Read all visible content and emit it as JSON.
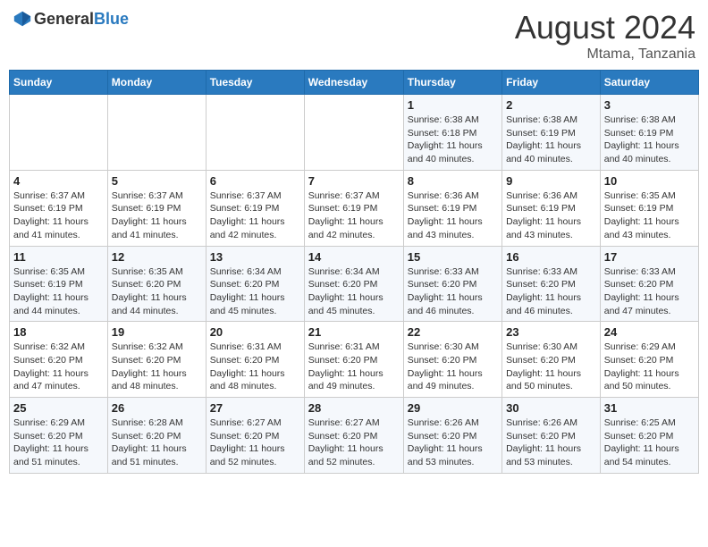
{
  "header": {
    "logo_general": "General",
    "logo_blue": "Blue",
    "month_title": "August 2024",
    "location": "Mtama, Tanzania"
  },
  "weekdays": [
    "Sunday",
    "Monday",
    "Tuesday",
    "Wednesday",
    "Thursday",
    "Friday",
    "Saturday"
  ],
  "weeks": [
    [
      {
        "day": "",
        "info": ""
      },
      {
        "day": "",
        "info": ""
      },
      {
        "day": "",
        "info": ""
      },
      {
        "day": "",
        "info": ""
      },
      {
        "day": "1",
        "info": "Sunrise: 6:38 AM\nSunset: 6:18 PM\nDaylight: 11 hours and 40 minutes."
      },
      {
        "day": "2",
        "info": "Sunrise: 6:38 AM\nSunset: 6:19 PM\nDaylight: 11 hours and 40 minutes."
      },
      {
        "day": "3",
        "info": "Sunrise: 6:38 AM\nSunset: 6:19 PM\nDaylight: 11 hours and 40 minutes."
      }
    ],
    [
      {
        "day": "4",
        "info": "Sunrise: 6:37 AM\nSunset: 6:19 PM\nDaylight: 11 hours and 41 minutes."
      },
      {
        "day": "5",
        "info": "Sunrise: 6:37 AM\nSunset: 6:19 PM\nDaylight: 11 hours and 41 minutes."
      },
      {
        "day": "6",
        "info": "Sunrise: 6:37 AM\nSunset: 6:19 PM\nDaylight: 11 hours and 42 minutes."
      },
      {
        "day": "7",
        "info": "Sunrise: 6:37 AM\nSunset: 6:19 PM\nDaylight: 11 hours and 42 minutes."
      },
      {
        "day": "8",
        "info": "Sunrise: 6:36 AM\nSunset: 6:19 PM\nDaylight: 11 hours and 43 minutes."
      },
      {
        "day": "9",
        "info": "Sunrise: 6:36 AM\nSunset: 6:19 PM\nDaylight: 11 hours and 43 minutes."
      },
      {
        "day": "10",
        "info": "Sunrise: 6:35 AM\nSunset: 6:19 PM\nDaylight: 11 hours and 43 minutes."
      }
    ],
    [
      {
        "day": "11",
        "info": "Sunrise: 6:35 AM\nSunset: 6:19 PM\nDaylight: 11 hours and 44 minutes."
      },
      {
        "day": "12",
        "info": "Sunrise: 6:35 AM\nSunset: 6:20 PM\nDaylight: 11 hours and 44 minutes."
      },
      {
        "day": "13",
        "info": "Sunrise: 6:34 AM\nSunset: 6:20 PM\nDaylight: 11 hours and 45 minutes."
      },
      {
        "day": "14",
        "info": "Sunrise: 6:34 AM\nSunset: 6:20 PM\nDaylight: 11 hours and 45 minutes."
      },
      {
        "day": "15",
        "info": "Sunrise: 6:33 AM\nSunset: 6:20 PM\nDaylight: 11 hours and 46 minutes."
      },
      {
        "day": "16",
        "info": "Sunrise: 6:33 AM\nSunset: 6:20 PM\nDaylight: 11 hours and 46 minutes."
      },
      {
        "day": "17",
        "info": "Sunrise: 6:33 AM\nSunset: 6:20 PM\nDaylight: 11 hours and 47 minutes."
      }
    ],
    [
      {
        "day": "18",
        "info": "Sunrise: 6:32 AM\nSunset: 6:20 PM\nDaylight: 11 hours and 47 minutes."
      },
      {
        "day": "19",
        "info": "Sunrise: 6:32 AM\nSunset: 6:20 PM\nDaylight: 11 hours and 48 minutes."
      },
      {
        "day": "20",
        "info": "Sunrise: 6:31 AM\nSunset: 6:20 PM\nDaylight: 11 hours and 48 minutes."
      },
      {
        "day": "21",
        "info": "Sunrise: 6:31 AM\nSunset: 6:20 PM\nDaylight: 11 hours and 49 minutes."
      },
      {
        "day": "22",
        "info": "Sunrise: 6:30 AM\nSunset: 6:20 PM\nDaylight: 11 hours and 49 minutes."
      },
      {
        "day": "23",
        "info": "Sunrise: 6:30 AM\nSunset: 6:20 PM\nDaylight: 11 hours and 50 minutes."
      },
      {
        "day": "24",
        "info": "Sunrise: 6:29 AM\nSunset: 6:20 PM\nDaylight: 11 hours and 50 minutes."
      }
    ],
    [
      {
        "day": "25",
        "info": "Sunrise: 6:29 AM\nSunset: 6:20 PM\nDaylight: 11 hours and 51 minutes."
      },
      {
        "day": "26",
        "info": "Sunrise: 6:28 AM\nSunset: 6:20 PM\nDaylight: 11 hours and 51 minutes."
      },
      {
        "day": "27",
        "info": "Sunrise: 6:27 AM\nSunset: 6:20 PM\nDaylight: 11 hours and 52 minutes."
      },
      {
        "day": "28",
        "info": "Sunrise: 6:27 AM\nSunset: 6:20 PM\nDaylight: 11 hours and 52 minutes."
      },
      {
        "day": "29",
        "info": "Sunrise: 6:26 AM\nSunset: 6:20 PM\nDaylight: 11 hours and 53 minutes."
      },
      {
        "day": "30",
        "info": "Sunrise: 6:26 AM\nSunset: 6:20 PM\nDaylight: 11 hours and 53 minutes."
      },
      {
        "day": "31",
        "info": "Sunrise: 6:25 AM\nSunset: 6:20 PM\nDaylight: 11 hours and 54 minutes."
      }
    ]
  ]
}
